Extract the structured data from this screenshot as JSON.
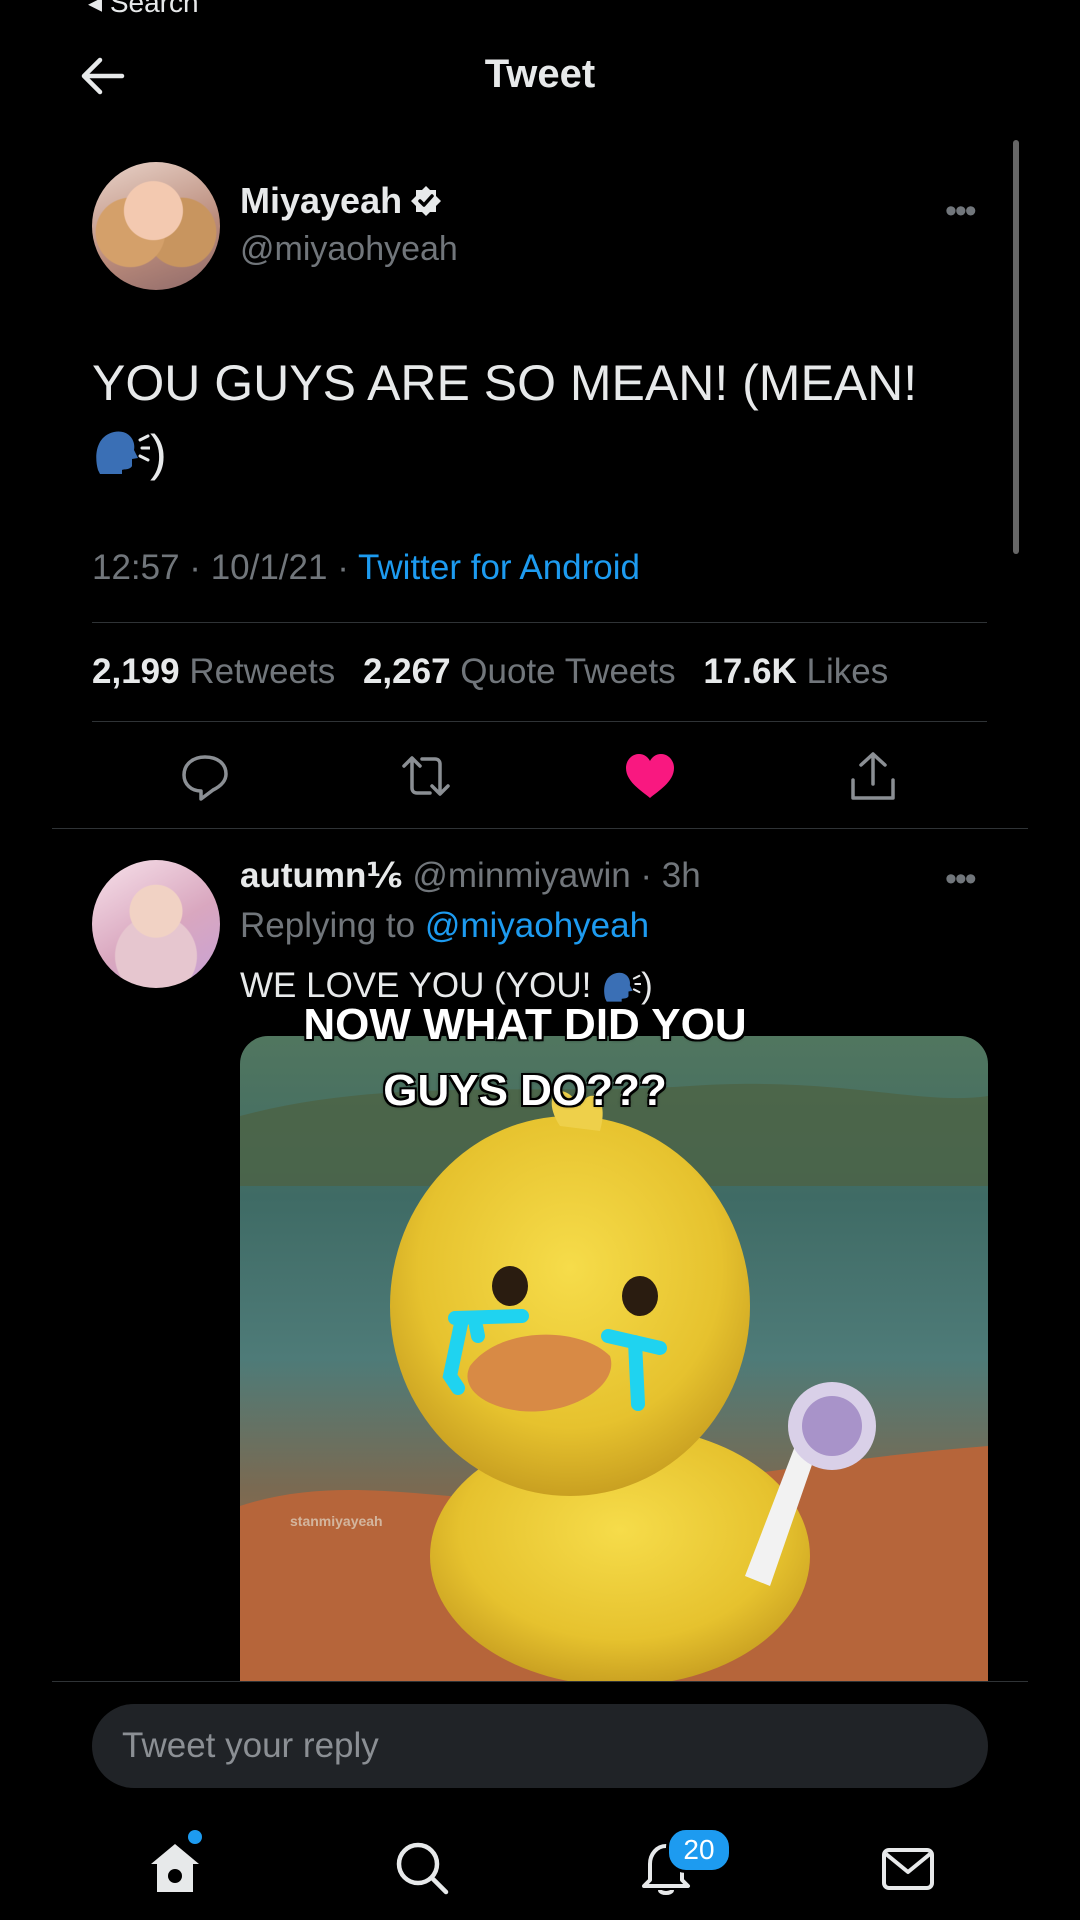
{
  "status_bar": {
    "back_label": "◂ Search"
  },
  "header": {
    "title": "Tweet"
  },
  "tweet": {
    "author_name": "Miyayeah",
    "author_handle": "@miyaohyeah",
    "text": "YOU GUYS ARE SO MEAN! (MEAN!",
    "text_end": ")",
    "time": "12:57 · 10/1/21 · ",
    "source": "Twitter for Android",
    "stats": {
      "retweets_count": "2,199",
      "retweets_label": "Retweets",
      "quotes_count": "2,267",
      "quotes_label": "Quote Tweets",
      "likes_count": "17.6K",
      "likes_label": "Likes"
    },
    "liked": true,
    "like_color": "#f91880"
  },
  "reply": {
    "author_name": "autumn⅙",
    "author_handle": "@minmiyawin",
    "age": " · 3h",
    "replying_prefix": "Replying to ",
    "replying_handle": "@miyaohyeah",
    "text": "WE LOVE YOU (YOU! ",
    "text_end": ")",
    "media_overlay_line1": "NOW WHAT DID YOU",
    "media_overlay_line2": "GUYS DO???",
    "media_watermark": "stanmiyayeah"
  },
  "composer": {
    "placeholder": "Tweet your reply"
  },
  "bottom_nav": {
    "items": [
      "home-icon",
      "search-icon",
      "notifications-icon",
      "messages-icon"
    ],
    "notifications_badge": "20"
  },
  "colors": {
    "accent": "#1d9bf0",
    "background": "#000000",
    "like": "#f91880"
  }
}
